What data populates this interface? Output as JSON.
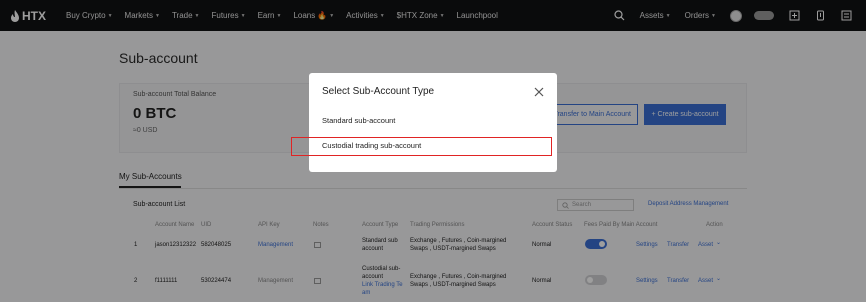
{
  "nav": {
    "logo": "HTX",
    "items": [
      {
        "label": "Buy Crypto",
        "caret": true
      },
      {
        "label": "Markets",
        "caret": true
      },
      {
        "label": "Trade",
        "caret": true
      },
      {
        "label": "Futures",
        "caret": true
      },
      {
        "label": "Earn",
        "caret": true
      },
      {
        "label": "Loans",
        "caret": false
      },
      {
        "label": "Activities",
        "caret": true
      },
      {
        "label": "$HTX Zone",
        "caret": true
      },
      {
        "label": "Launchpool",
        "caret": false
      }
    ],
    "right": {
      "assets": "Assets",
      "orders": "Orders"
    },
    "colors": {
      "background": "#111214",
      "text": "#e8e8e8"
    }
  },
  "page": {
    "title": "Sub-account",
    "balance_label": "Sub-account Total Balance",
    "balance_value": "0 BTC",
    "balance_fiat": "≈0 USD",
    "transfer_button": "Transfer to Main Account",
    "create_button": "+ Create sub-account"
  },
  "tabs": {
    "my_sub_accounts": "My Sub-Accounts"
  },
  "list": {
    "title": "Sub-account List",
    "search_placeholder": "Search",
    "deposit_link": "Deposit Address Management",
    "columns": [
      "Account Name",
      "UID",
      "API Key",
      "Notes",
      "Account Type",
      "Trading Permissions",
      "Account Status",
      "Fees Paid By Main Account",
      "Action"
    ],
    "rows": [
      {
        "index": "1",
        "name": "jason12312322",
        "uid": "582048025",
        "api": "Management",
        "type_line1": "Standard sub",
        "type_line2": "account",
        "type_link": "",
        "permissions_line1": "Exchange , Futures , Coin-margined",
        "permissions_line2": "Swaps , USDT-margined Swaps",
        "status": "Normal",
        "fees_on": true,
        "actions": [
          "Settings",
          "Transfer",
          "Asset"
        ]
      },
      {
        "index": "2",
        "name": "f1111111",
        "uid": "530224474",
        "api": "Management",
        "type_line1": "Custodial sub-",
        "type_line2": "account",
        "type_link": "Link Trading Te am",
        "permissions_line1": "Exchange , Futures , Coin-margined",
        "permissions_line2": "Swaps , USDT-margined Swaps",
        "status": "Normal",
        "fees_on": false,
        "actions": [
          "Settings",
          "Transfer",
          "Asset"
        ]
      }
    ]
  },
  "modal": {
    "title": "Select Sub-Account Type",
    "options": [
      "Standard sub-account",
      "Custodial trading sub-account"
    ],
    "highlight_color": "#e02424"
  },
  "colors": {
    "accent": "#3b6fd4",
    "page_bg": "#f5f5f7"
  }
}
